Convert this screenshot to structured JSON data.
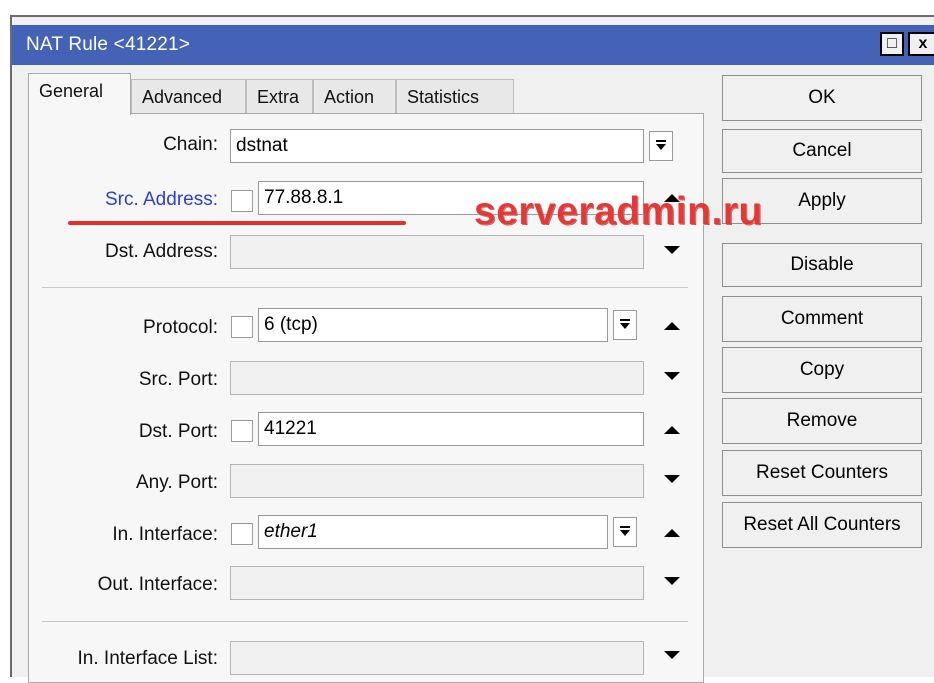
{
  "window": {
    "title": "NAT Rule <41221>",
    "maximize_glyph": "□",
    "close_glyph": "x"
  },
  "tabs": [
    {
      "label": "General",
      "active": true
    },
    {
      "label": "Advanced",
      "active": false
    },
    {
      "label": "Extra",
      "active": false
    },
    {
      "label": "Action",
      "active": false
    },
    {
      "label": "Statistics",
      "active": false
    }
  ],
  "form": {
    "chain": {
      "label": "Chain:",
      "value": "dstnat"
    },
    "src_address": {
      "label": "Src. Address:",
      "value": "77.88.8.1"
    },
    "dst_address": {
      "label": "Dst. Address:",
      "value": ""
    },
    "protocol": {
      "label": "Protocol:",
      "value": "6 (tcp)"
    },
    "src_port": {
      "label": "Src. Port:",
      "value": ""
    },
    "dst_port": {
      "label": "Dst. Port:",
      "value": "41221"
    },
    "any_port": {
      "label": "Any. Port:",
      "value": ""
    },
    "in_interface": {
      "label": "In. Interface:",
      "value": "ether1"
    },
    "out_interface": {
      "label": "Out. Interface:",
      "value": ""
    },
    "in_interface_list": {
      "label": "In. Interface List:",
      "value": ""
    }
  },
  "buttons": {
    "ok": "OK",
    "cancel": "Cancel",
    "apply": "Apply",
    "disable": "Disable",
    "comment": "Comment",
    "copy": "Copy",
    "remove": "Remove",
    "reset_counters": "Reset Counters",
    "reset_all_counters": "Reset All Counters"
  },
  "watermark": "serveradmin.ru",
  "colors": {
    "titlebar": "#4463b6",
    "link_label": "#2b3fd6",
    "annotation": "#e3302d"
  },
  "icons": [
    "dropdown-icon",
    "arrow-up-icon",
    "arrow-down-icon",
    "maximize-icon",
    "close-icon"
  ]
}
